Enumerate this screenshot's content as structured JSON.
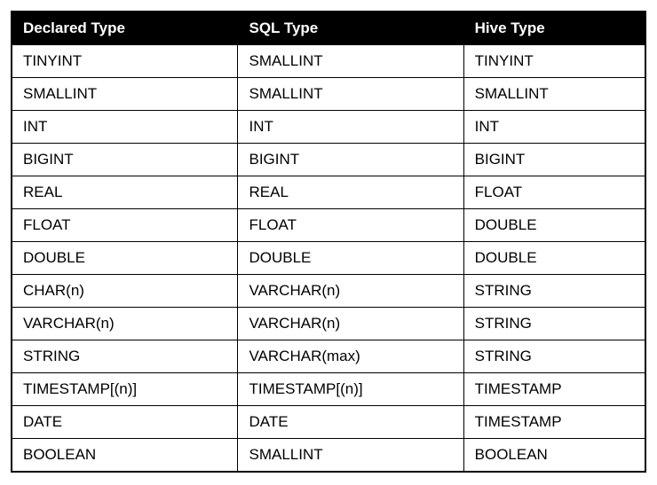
{
  "chart_data": {
    "type": "table",
    "headers": [
      "Declared Type",
      "SQL Type",
      "Hive Type"
    ],
    "rows": [
      [
        "TINYINT",
        "SMALLINT",
        "TINYINT"
      ],
      [
        "SMALLINT",
        "SMALLINT",
        "SMALLINT"
      ],
      [
        "INT",
        "INT",
        "INT"
      ],
      [
        "BIGINT",
        "BIGINT",
        "BIGINT"
      ],
      [
        "REAL",
        "REAL",
        "FLOAT"
      ],
      [
        "FLOAT",
        "FLOAT",
        "DOUBLE"
      ],
      [
        "DOUBLE",
        "DOUBLE",
        "DOUBLE"
      ],
      [
        "CHAR(n)",
        "VARCHAR(n)",
        "STRING"
      ],
      [
        "VARCHAR(n)",
        "VARCHAR(n)",
        "STRING"
      ],
      [
        "STRING",
        "VARCHAR(max)",
        "STRING"
      ],
      [
        "TIMESTAMP[(n)]",
        "TIMESTAMP[(n)]",
        "TIMESTAMP"
      ],
      [
        "DATE",
        "DATE",
        "TIMESTAMP"
      ],
      [
        "BOOLEAN",
        "SMALLINT",
        "BOOLEAN"
      ]
    ]
  }
}
